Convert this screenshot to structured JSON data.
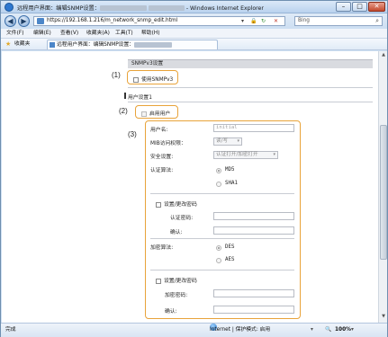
{
  "window": {
    "title": "远程用户界面：编辑SNMP设置 - Windows Internet Explorer",
    "title_prefix": "远程用户界面：编辑SNMP设置：",
    "title_suffix": "- Windows Internet Explorer"
  },
  "address": {
    "url": "https://192.168.1.216/m_network_snmp_edit.html",
    "search_placeholder": "Bing"
  },
  "menu": [
    "文件(F)",
    "编辑(E)",
    "查看(V)",
    "收藏夹(A)",
    "工具(T)",
    "帮助(H)"
  ],
  "favorites": {
    "label": "收藏夹",
    "tab_title": "远程用户界面：编辑SNMP设置："
  },
  "snmpv3": {
    "section_title": "SNMPv3设置",
    "use_label": "使用SNMPv3"
  },
  "user": {
    "heading": "用户设置1",
    "enable_label": "启用用户",
    "username_label": "用户名:",
    "username_value": "initial",
    "mib_label": "MIB访问权限：",
    "mib_value": "读/写",
    "security_label": "安全设置:",
    "security_value": "认证打开/加密打开",
    "auth_alg_label": "认证算法:",
    "auth_options": [
      "MD5",
      "SHA1"
    ],
    "change_password_label": "设置/更改密码",
    "auth_password_label": "认证密码:",
    "confirm_label": "确认:",
    "enc_alg_label": "加密算法:",
    "enc_options": [
      "DES",
      "AES"
    ],
    "enc_password_label": "加密密码:"
  },
  "callouts": [
    "(1)",
    "(2)",
    "(3)"
  ],
  "status": {
    "left": "完成",
    "zone": "Internet | 保护模式: 启用",
    "zoom": "100%"
  },
  "colors": {
    "callout": "#e8a33a",
    "window_frame": "#6f8fb0"
  }
}
